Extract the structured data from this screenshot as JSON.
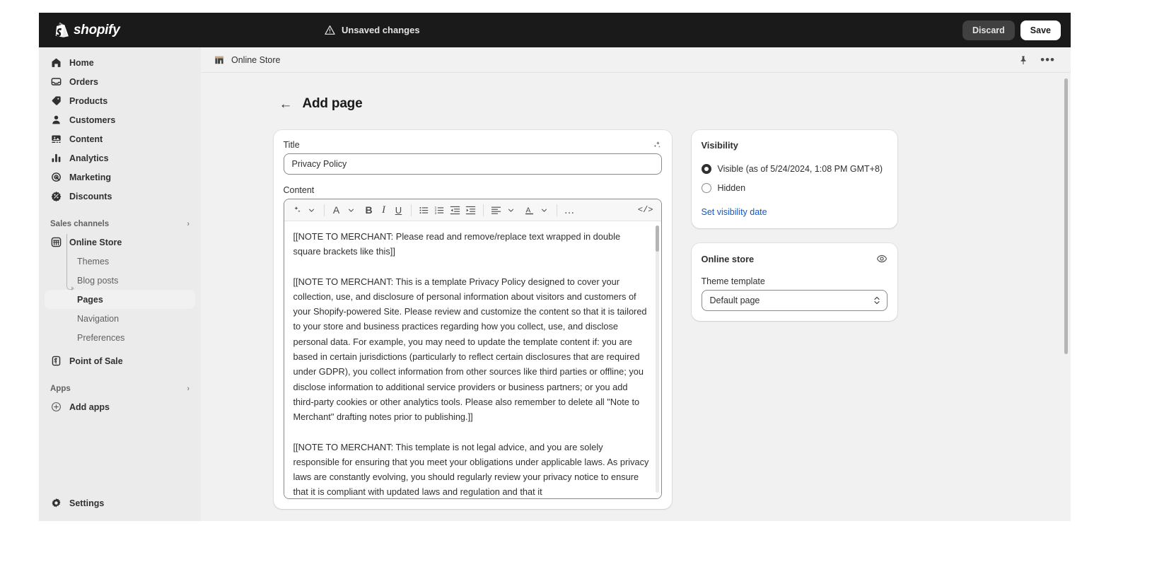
{
  "topbar": {
    "brand": "shopify",
    "status_text": "Unsaved changes",
    "status_icon": "warning-icon",
    "discard_label": "Discard",
    "save_label": "Save"
  },
  "sidebar": {
    "items": [
      {
        "label": "Home",
        "icon": "home-icon"
      },
      {
        "label": "Orders",
        "icon": "orders-icon"
      },
      {
        "label": "Products",
        "icon": "tag-icon"
      },
      {
        "label": "Customers",
        "icon": "person-icon"
      },
      {
        "label": "Content",
        "icon": "content-icon"
      },
      {
        "label": "Analytics",
        "icon": "bar-chart-icon"
      },
      {
        "label": "Marketing",
        "icon": "target-icon"
      },
      {
        "label": "Discounts",
        "icon": "discount-icon"
      }
    ],
    "sales_channels": {
      "label": "Sales channels",
      "chevron": "›",
      "items": [
        {
          "label": "Online Store",
          "icon": "store-icon"
        },
        {
          "label": "Themes"
        },
        {
          "label": "Blog posts"
        },
        {
          "label": "Pages",
          "active": true
        },
        {
          "label": "Navigation"
        },
        {
          "label": "Preferences"
        }
      ],
      "point_of_sale": {
        "label": "Point of Sale",
        "icon": "pos-icon"
      }
    },
    "apps": {
      "label": "Apps",
      "chevron": "›",
      "add_apps": {
        "label": "Add apps",
        "icon": "plus-circle-icon"
      }
    },
    "settings": {
      "label": "Settings",
      "icon": "gear-icon"
    }
  },
  "breadcrumb": {
    "label": "Online Store",
    "icon": "store-icon",
    "pin_icon": "pin-icon",
    "more_icon": "more-horizontal-icon"
  },
  "page": {
    "back_arrow": "←",
    "title": "Add page"
  },
  "form": {
    "title_label": "Title",
    "title_value": "Privacy Policy",
    "title_placeholder": "",
    "magic_icon": "magic-sparkle-icon",
    "content_label": "Content",
    "toolbar": {
      "magic": "magic-sparkle-icon",
      "magic_chevron": "⌄",
      "paragraph_style": "A",
      "paragraph_chevron": "⌄",
      "bold": "B",
      "italic": "I",
      "underline": "U",
      "bullet_list": "bulleted-list-icon",
      "numbered_list": "numbered-list-icon",
      "outdent": "outdent-icon",
      "indent": "indent-icon",
      "align": "align-left-icon",
      "align_chevron": "⌄",
      "text_color": "A",
      "text_color_chevron": "⌄",
      "more": "…",
      "code": "</>"
    },
    "content_paragraphs": [
      "[[NOTE TO MERCHANT: Please read and remove/replace text wrapped in double square brackets like this]]",
      "[[NOTE TO MERCHANT: This is a template Privacy Policy designed to cover your collection, use, and disclosure of personal information about visitors and customers of your Shopify-powered Site. Please review and customize the content so that it is tailored to your store and business practices regarding how you collect, use, and disclose personal data. For example, you may need to update the template content if: you are based in certain jurisdictions (particularly to reflect certain disclosures that are required under GDPR), you collect information from other sources like third parties or offline; you disclose information to additional service providers or business partners; or you add third-party cookies or other analytics tools. Please also remember to delete all \"Note to Merchant\" drafting notes prior to publishing.]]",
      "[[NOTE TO MERCHANT: This template is not legal advice, and you are solely responsible for ensuring that you meet your obligations under applicable laws. As privacy laws are constantly evolving, you should regularly review your privacy notice to ensure that it is compliant with updated laws and regulation and that it"
    ]
  },
  "visibility": {
    "title": "Visibility",
    "options": [
      {
        "label": "Visible (as of 5/24/2024, 1:08 PM GMT+8)",
        "selected": true
      },
      {
        "label": "Hidden",
        "selected": false
      }
    ],
    "set_date_link": "Set visibility date"
  },
  "online_store": {
    "title": "Online store",
    "eye_icon": "eye-icon",
    "theme_template_label": "Theme template",
    "theme_template_value": "Default page",
    "theme_template_options": [
      "Default page"
    ]
  },
  "colors": {
    "topbar_bg": "#1a1a1a",
    "sidebar_bg": "#ebebeb",
    "canvas_bg": "#f1f1f1",
    "card_bg": "#ffffff",
    "link": "#0a5ad6",
    "text": "#303030"
  }
}
